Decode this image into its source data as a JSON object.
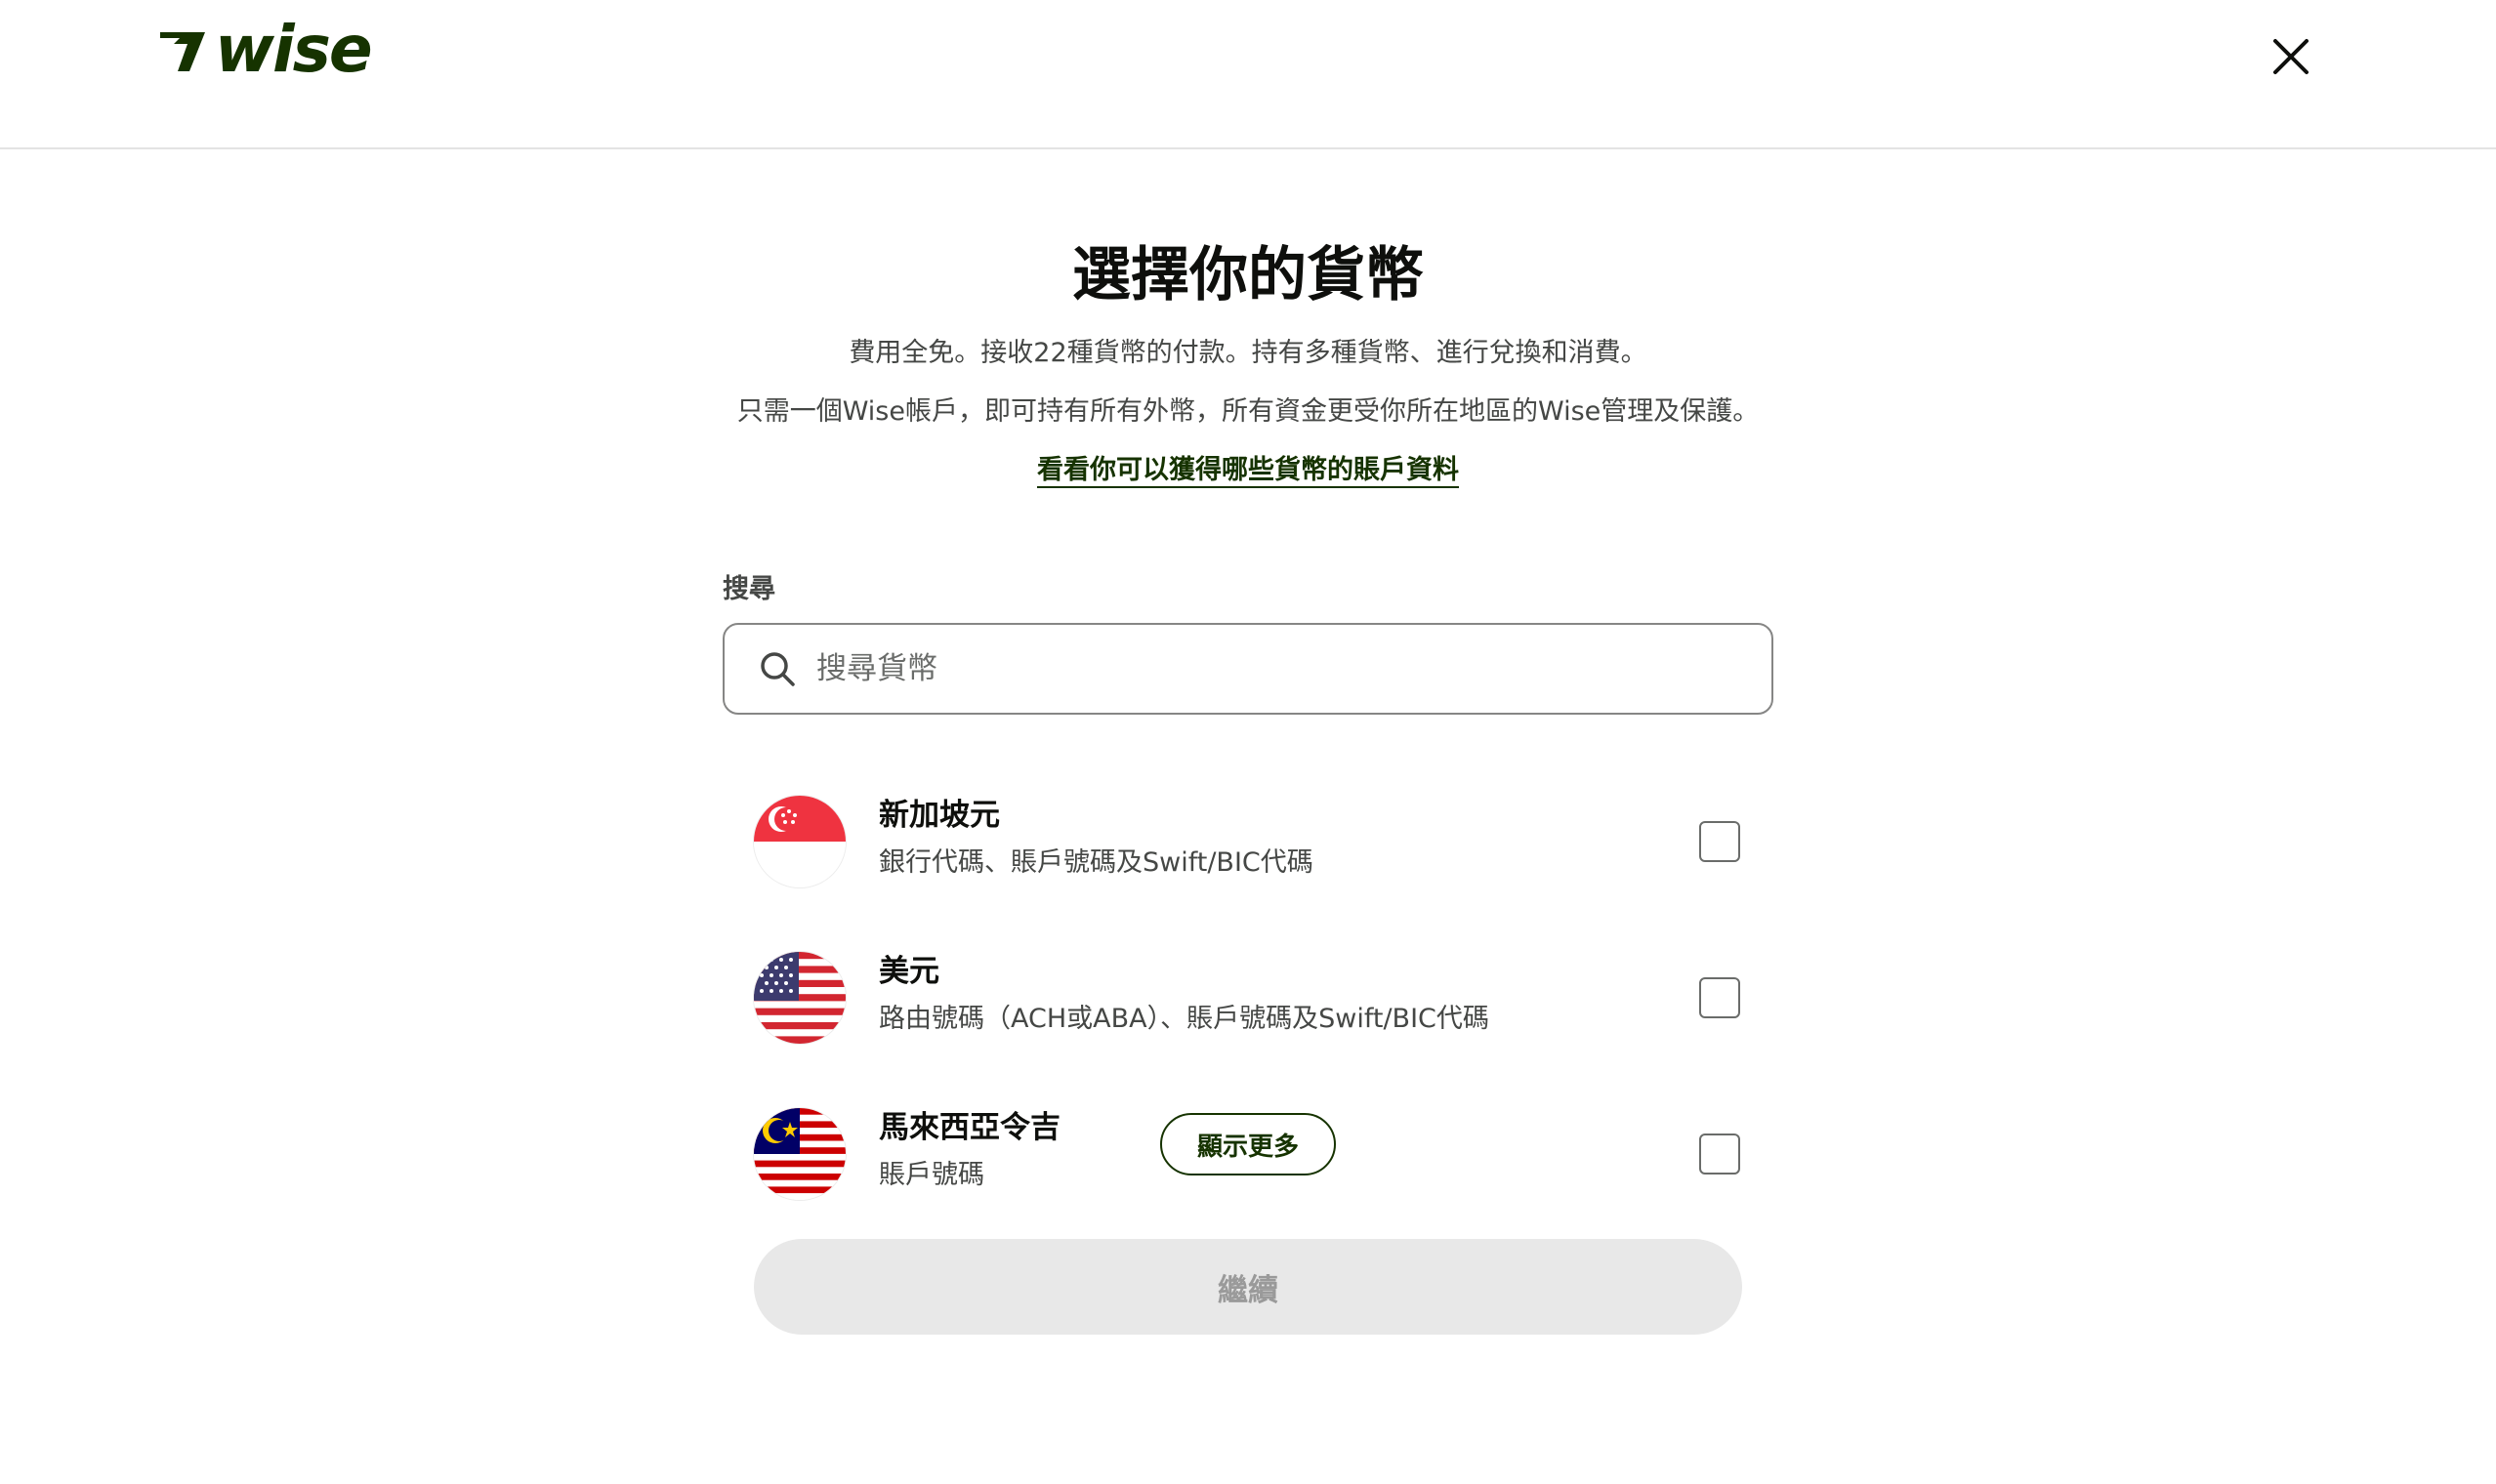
{
  "header": {
    "logo_text": "wise",
    "logo_icon": "wise-flag-icon",
    "close_icon": "close-icon"
  },
  "main": {
    "title": "選擇你的貨幣",
    "description_line1": "費用全免。接收22種貨幣的付款。持有多種貨幣、進行兌換和消費。",
    "description_line2": "只需一個Wise帳戶，即可持有所有外幣，所有資金更受你所在地區的Wise管理及保護。",
    "details_link": "看看你可以獲得哪些貨幣的賬戶資料"
  },
  "search": {
    "label": "搜尋",
    "placeholder": "搜尋貨幣",
    "value": "",
    "icon": "search-icon"
  },
  "currencies": [
    {
      "name": "新加坡元",
      "details": "銀行代碼、賬戶號碼及Swift/BIC代碼",
      "flag": "singapore-flag-icon",
      "checked": false
    },
    {
      "name": "美元",
      "details": "路由號碼（ACH或ABA）、賬戶號碼及Swift/BIC代碼",
      "flag": "usa-flag-icon",
      "checked": false
    },
    {
      "name": "馬來西亞令吉",
      "details": "賬戶號碼",
      "flag": "malaysia-flag-icon",
      "checked": false
    }
  ],
  "actions": {
    "show_more_label": "顯示更多",
    "continue_label": "繼續",
    "continue_disabled": true
  },
  "colors": {
    "brand": "#163300",
    "text_primary": "#0e0f0c",
    "text_secondary": "#454745",
    "disabled_bg": "#e8e8e8",
    "disabled_text": "#9a9a9a"
  }
}
